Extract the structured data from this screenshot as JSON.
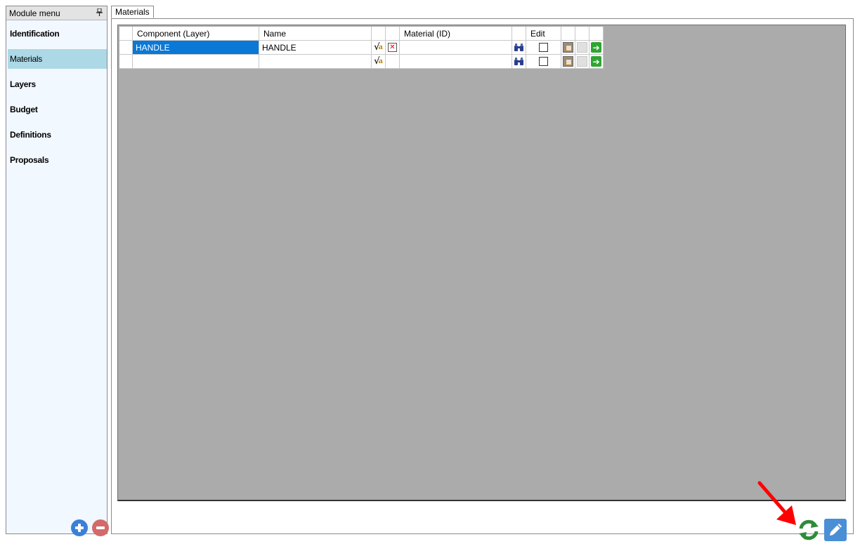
{
  "module_menu": {
    "title": "Module menu",
    "pin_glyph": "⊥",
    "items": [
      {
        "label": "Identification",
        "active": false
      },
      {
        "label": "Materials",
        "active": true
      },
      {
        "label": "Layers",
        "active": false
      },
      {
        "label": "Budget",
        "active": false
      },
      {
        "label": "Definitions",
        "active": false
      },
      {
        "label": "Proposals",
        "active": false
      }
    ]
  },
  "tabs": [
    {
      "label": "Materials",
      "active": true
    }
  ],
  "grid": {
    "columns": [
      "",
      "Component (Layer)",
      "Name",
      "",
      "",
      "Material (ID)",
      "",
      "Edit",
      "",
      "",
      ""
    ],
    "rows": [
      {
        "component": "HANDLE",
        "name": "HANDLE",
        "material_id": "",
        "edit": false,
        "selected": true,
        "has_delete": true
      },
      {
        "component": "",
        "name": "",
        "material_id": "",
        "edit": false,
        "selected": false,
        "has_delete": false
      }
    ]
  },
  "icons": {
    "formula": "formula-icon",
    "delete": "delete-icon",
    "search": "binoculars-icon",
    "edit_item": "edit-item-icon",
    "placeholder": "blank-icon",
    "go": "go-arrow-icon",
    "add": "add-icon",
    "remove": "remove-icon",
    "refresh": "refresh-icon",
    "edit": "pencil-icon",
    "annotation": "red-arrow-annotation"
  },
  "colors": {
    "selection": "#0a78d7",
    "menu_active": "#add8e6",
    "grid_background": "#ababab",
    "refresh_green": "#2e8b3a",
    "edit_blue": "#4a8ed6",
    "annotation_red": "#ff0000"
  }
}
